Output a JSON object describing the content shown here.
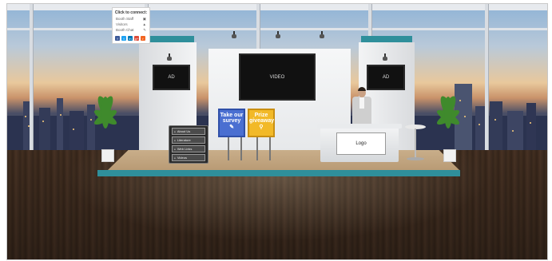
{
  "connect_panel": {
    "title": "Click to connect:",
    "rows": [
      {
        "label": "Booth Staff"
      },
      {
        "label": "Visitors"
      },
      {
        "label": "Booth Chat"
      }
    ],
    "social": [
      {
        "name": "facebook",
        "glyph": "f",
        "color": "#3b5998"
      },
      {
        "name": "twitter",
        "glyph": "t",
        "color": "#1da1f2"
      },
      {
        "name": "linkedin",
        "glyph": "in",
        "color": "#0077b5"
      },
      {
        "name": "google-plus",
        "glyph": "g+",
        "color": "#dd4b39"
      },
      {
        "name": "rss",
        "glyph": "r",
        "color": "#f26522"
      }
    ]
  },
  "screens": {
    "left_ad": "AD",
    "video": "VIDEO",
    "right_ad": "AD"
  },
  "kiosk_buttons": [
    "About Us",
    "Literature",
    "Web Links",
    "Videos"
  ],
  "signs": {
    "survey": "Take our survey",
    "prize": "Prize giveaway"
  },
  "desk": {
    "logo": "Logo"
  },
  "colors": {
    "accent_teal": "#2f8f9b",
    "survey_blue": "#4a6fd1",
    "prize_yellow": "#f2b928"
  }
}
